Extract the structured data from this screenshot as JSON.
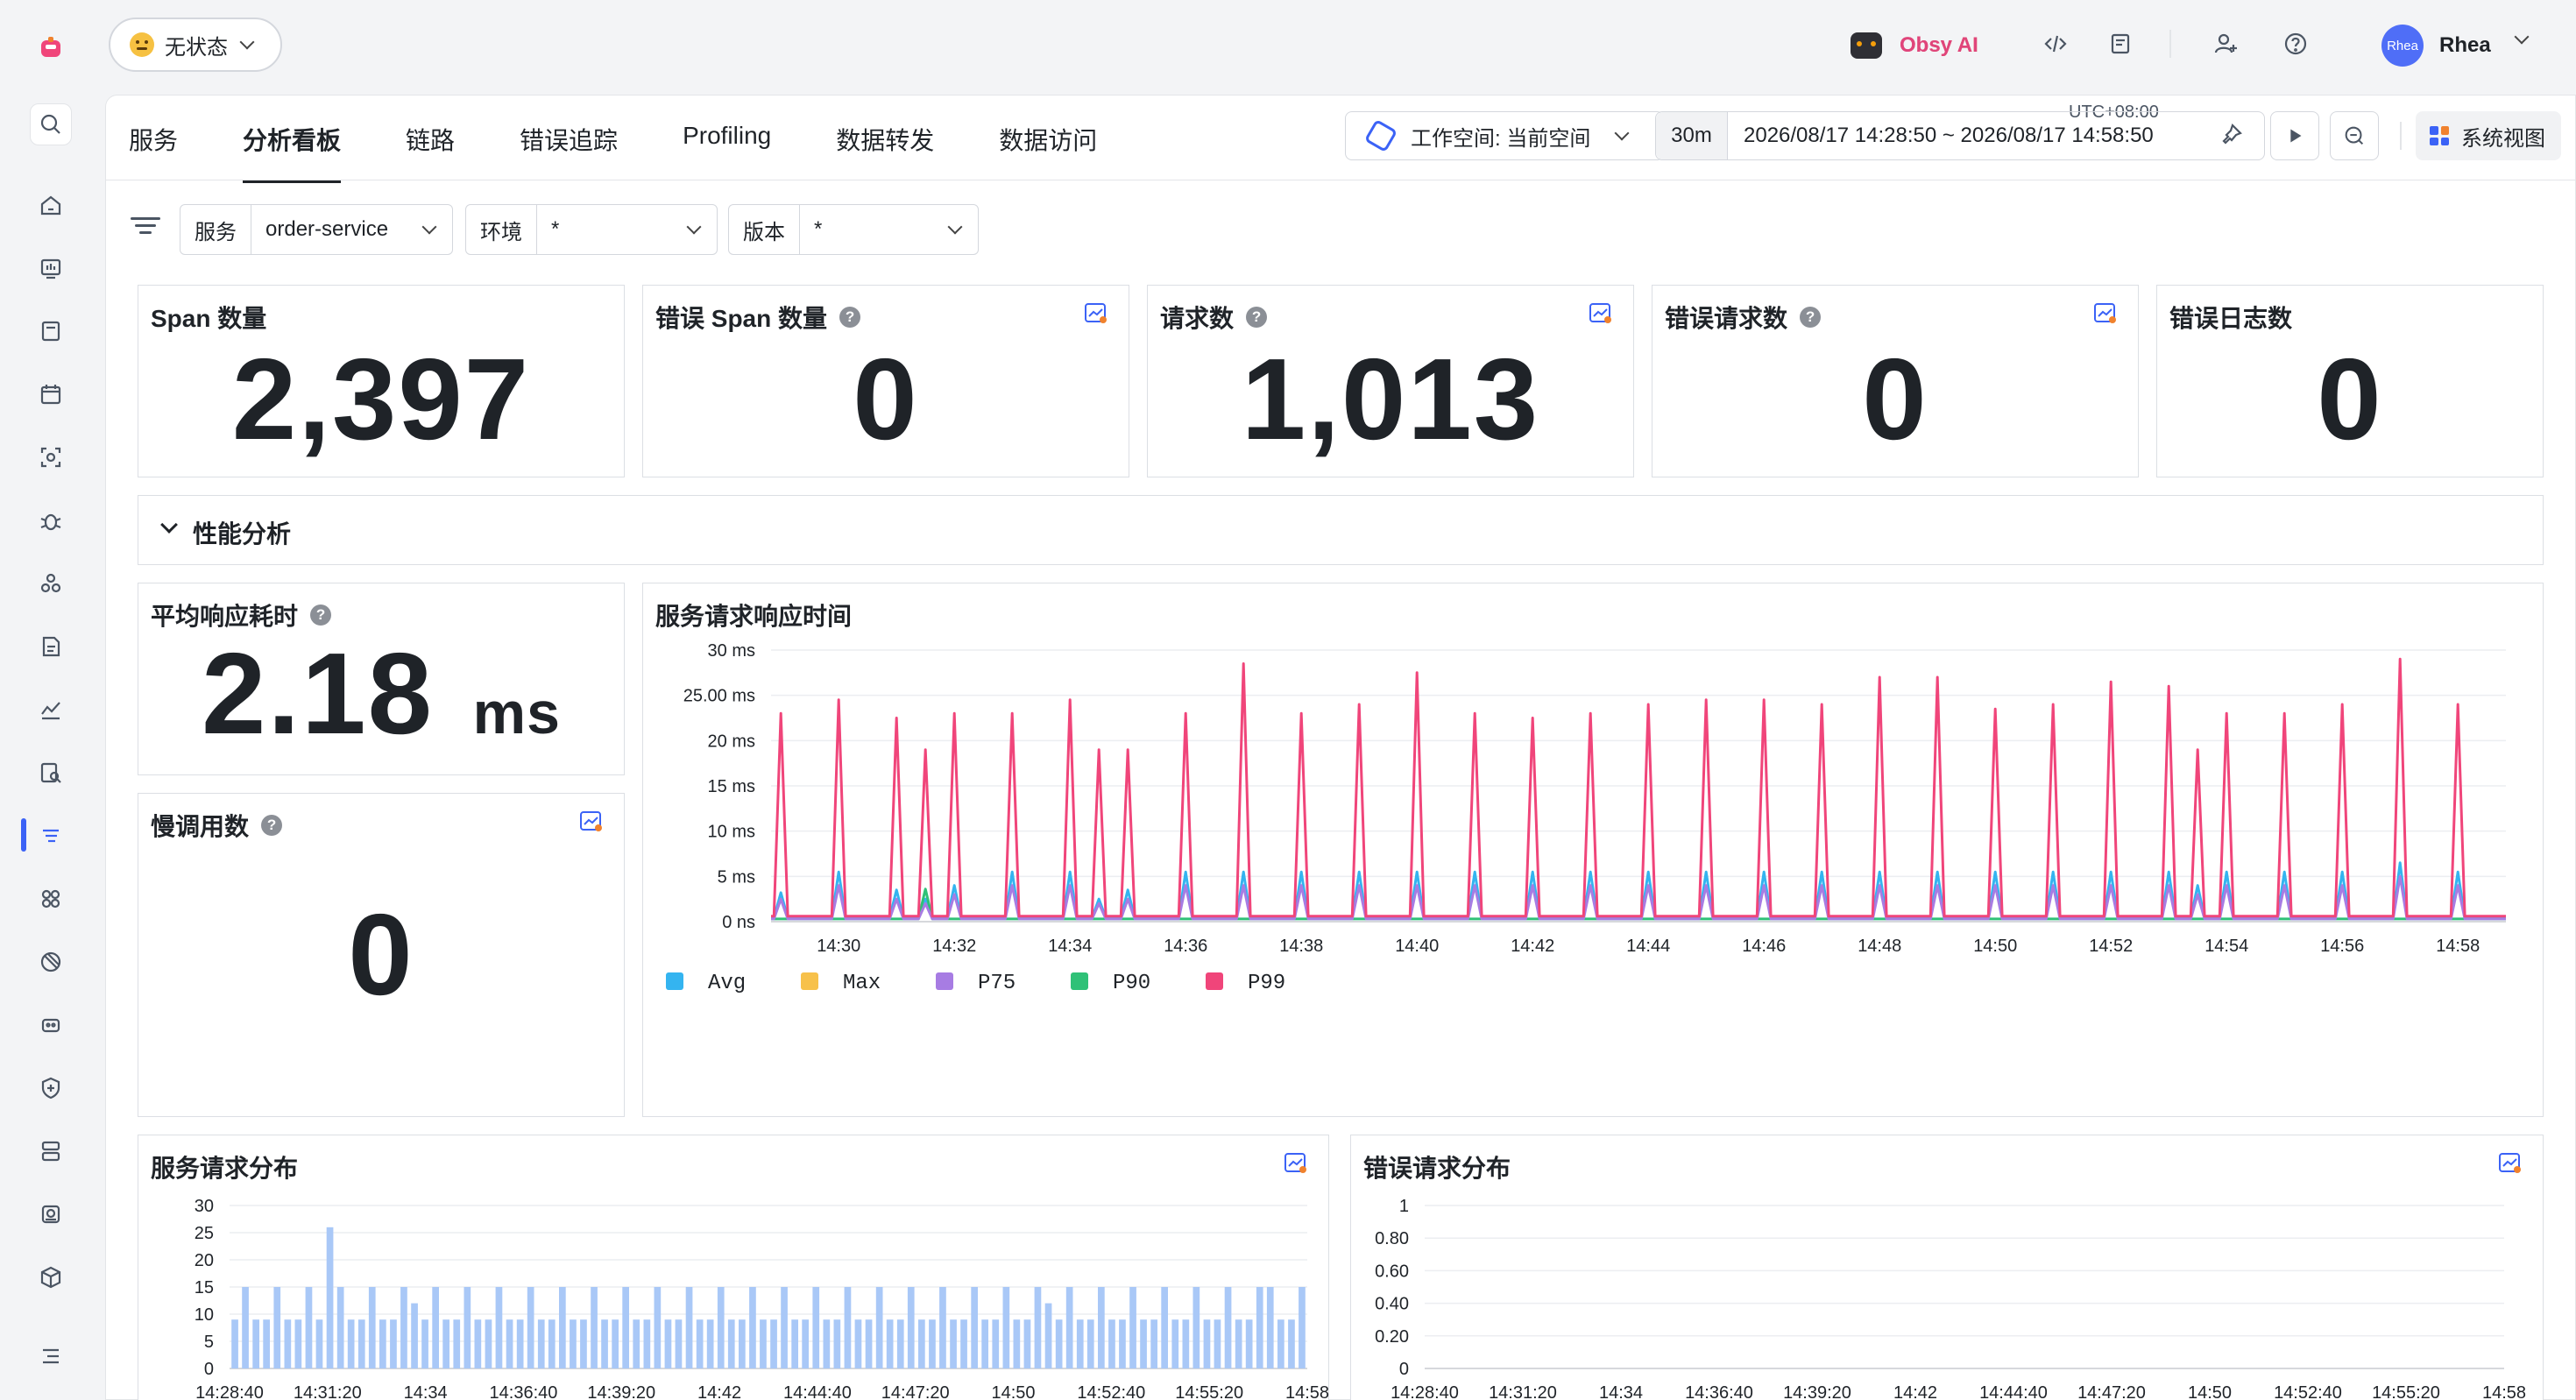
{
  "topbar": {
    "status_label": "无状态",
    "ai_label": "Obsy AI",
    "user_avatar_text": "Rhea",
    "user_name": "Rhea"
  },
  "tabs": [
    {
      "label": "服务",
      "active": false
    },
    {
      "label": "分析看板",
      "active": true
    },
    {
      "label": "链路",
      "active": false
    },
    {
      "label": "错误追踪",
      "active": false
    },
    {
      "label": "Profiling",
      "active": false
    },
    {
      "label": "数据转发",
      "active": false
    },
    {
      "label": "数据访问",
      "active": false
    }
  ],
  "toolbar": {
    "workspace_label": "工作空间: 当前空间",
    "time_short": "30m",
    "time_range": "2026/08/17 14:28:50 ~ 2026/08/17 14:58:50",
    "timezone": "UTC+08:00",
    "system_view_label": "系统视图"
  },
  "filters": {
    "service": {
      "label": "服务",
      "value": "order-service"
    },
    "env": {
      "label": "环境",
      "value": "*"
    },
    "version": {
      "label": "版本",
      "value": "*"
    }
  },
  "stats": {
    "span_count": {
      "title": "Span 数量",
      "value": "2,397"
    },
    "error_span_count": {
      "title": "错误 Span 数量",
      "value": "0"
    },
    "request_count": {
      "title": "请求数",
      "value": "1,013"
    },
    "error_request_count": {
      "title": "错误请求数",
      "value": "0"
    },
    "error_log_count": {
      "title": "错误日志数",
      "value": "0"
    }
  },
  "section": {
    "title": "性能分析"
  },
  "avg_response": {
    "title": "平均响应耗时",
    "value": "2.18",
    "unit": "ms"
  },
  "slow_calls": {
    "title": "慢调用数",
    "value": "0"
  },
  "colors": {
    "accent": "#3b62f6",
    "avg": "#34b4f0",
    "max": "#f7c14a",
    "p75": "#a77ce3",
    "p90": "#2fc177",
    "p99": "#f0457a",
    "bar": "#a9c8f7"
  },
  "chart_data": [
    {
      "type": "line",
      "title": "服务请求响应时间",
      "ylim": [
        0,
        30
      ],
      "y_ticks": [
        "30 ms",
        "25.00 ms",
        "20 ms",
        "15 ms",
        "10 ms",
        "5 ms",
        "0 ns"
      ],
      "x_ticks": [
        "14:30",
        "14:32",
        "14:34",
        "14:36",
        "14:38",
        "14:40",
        "14:42",
        "14:44",
        "14:46",
        "14:48",
        "14:50",
        "14:52",
        "14:54",
        "14:56",
        "14:58"
      ],
      "legend_position": "bottom-left",
      "grid": true,
      "x_minutes": [
        28.83,
        29,
        29.5,
        30,
        30.5,
        31,
        31.5,
        32,
        32.5,
        33,
        33.5,
        34,
        34.5,
        35,
        35.5,
        36,
        36.5,
        37,
        37.5,
        38,
        38.5,
        39,
        39.5,
        40,
        40.5,
        41,
        41.5,
        42,
        42.5,
        43,
        43.5,
        44,
        44.5,
        45,
        45.5,
        46,
        46.5,
        47,
        47.5,
        48,
        48.5,
        49,
        49.5,
        50,
        50.5,
        51,
        51.5,
        52,
        52.5,
        53,
        53.5,
        54,
        54.5,
        55,
        55.5,
        56,
        56.5,
        57,
        57.5,
        58,
        58.5,
        58.83
      ],
      "series": [
        {
          "name": "Avg",
          "peaks": [
            [
              29,
              3.2
            ],
            [
              30,
              5.5
            ],
            [
              31,
              3.5
            ],
            [
              31.5,
              2.5
            ],
            [
              32,
              4.0
            ],
            [
              33,
              5.5
            ],
            [
              34,
              5.5
            ],
            [
              34.5,
              2.5
            ],
            [
              35,
              3.5
            ],
            [
              36,
              5.5
            ],
            [
              37,
              5.5
            ],
            [
              38,
              5.5
            ],
            [
              39,
              5.5
            ],
            [
              40,
              5.5
            ],
            [
              41,
              5.5
            ],
            [
              42,
              5.5
            ],
            [
              43,
              5.5
            ],
            [
              44,
              5.5
            ],
            [
              45,
              5.5
            ],
            [
              46,
              5.5
            ],
            [
              47,
              5.5
            ],
            [
              48,
              5.5
            ],
            [
              49,
              5.5
            ],
            [
              50,
              5.5
            ],
            [
              51,
              5.5
            ],
            [
              52,
              5.5
            ],
            [
              53,
              5.5
            ],
            [
              53.5,
              4.0
            ],
            [
              54,
              5.5
            ],
            [
              55,
              5.5
            ],
            [
              56,
              5.5
            ],
            [
              57,
              6.5
            ],
            [
              58,
              5.5
            ]
          ]
        },
        {
          "name": "Max",
          "peaks": []
        },
        {
          "name": "P75",
          "peaks": [
            [
              29,
              2.5
            ],
            [
              30,
              4.0
            ],
            [
              31,
              2.5
            ],
            [
              31.5,
              2.0
            ],
            [
              32,
              3.0
            ],
            [
              33,
              4.0
            ],
            [
              34,
              4.0
            ],
            [
              34.5,
              2.0
            ],
            [
              35,
              2.5
            ],
            [
              36,
              4.0
            ],
            [
              37,
              4.0
            ],
            [
              38,
              4.0
            ],
            [
              39,
              4.0
            ],
            [
              40,
              4.0
            ],
            [
              41,
              4.0
            ],
            [
              42,
              4.0
            ],
            [
              43,
              4.0
            ],
            [
              44,
              4.0
            ],
            [
              45,
              4.0
            ],
            [
              46,
              4.0
            ],
            [
              47,
              4.0
            ],
            [
              48,
              4.0
            ],
            [
              49,
              4.0
            ],
            [
              50,
              4.0
            ],
            [
              51,
              4.0
            ],
            [
              52,
              4.0
            ],
            [
              53,
              4.0
            ],
            [
              53.5,
              3.0
            ],
            [
              54,
              4.0
            ],
            [
              55,
              4.0
            ],
            [
              56,
              4.0
            ],
            [
              57,
              5.0
            ],
            [
              58,
              4.0
            ]
          ]
        },
        {
          "name": "P90",
          "peaks": [
            [
              31.5,
              3.6
            ]
          ]
        },
        {
          "name": "P99",
          "peaks": [
            [
              29,
              23.0
            ],
            [
              30,
              24.5
            ],
            [
              31,
              22.5
            ],
            [
              31.5,
              19.0
            ],
            [
              32,
              23.0
            ],
            [
              33,
              23.0
            ],
            [
              34,
              24.5
            ],
            [
              34.5,
              19.0
            ],
            [
              35,
              19.0
            ],
            [
              36,
              23.0
            ],
            [
              37,
              28.5
            ],
            [
              38,
              23.0
            ],
            [
              39,
              24.0
            ],
            [
              40,
              27.5
            ],
            [
              41,
              23.0
            ],
            [
              42,
              22.5
            ],
            [
              43,
              23.0
            ],
            [
              44,
              24.0
            ],
            [
              45,
              24.5
            ],
            [
              46,
              24.5
            ],
            [
              47,
              24.0
            ],
            [
              48,
              27.0
            ],
            [
              49,
              27.0
            ],
            [
              50,
              23.5
            ],
            [
              51,
              24.0
            ],
            [
              52,
              26.5
            ],
            [
              53,
              26.0
            ],
            [
              53.5,
              19.0
            ],
            [
              54,
              23.0
            ],
            [
              55,
              23.0
            ],
            [
              56,
              24.0
            ],
            [
              57,
              29.0
            ],
            [
              58,
              24.0
            ],
            [
              59,
              24.5
            ]
          ]
        }
      ]
    },
    {
      "type": "bar",
      "title": "服务请求分布",
      "ylim": [
        0,
        30
      ],
      "y_ticks": [
        "30",
        "25",
        "20",
        "15",
        "10",
        "5",
        "0"
      ],
      "x_ticks": [
        "14:28:40",
        "14:31:20",
        "14:34",
        "14:36:40",
        "14:39:20",
        "14:42",
        "14:44:40",
        "14:47:20",
        "14:50",
        "14:52:40",
        "14:55:20",
        "14:58"
      ],
      "grid": true,
      "values": [
        9,
        15,
        9,
        9,
        15,
        9,
        9,
        15,
        9,
        26,
        15,
        9,
        9,
        15,
        9,
        9,
        15,
        12,
        9,
        15,
        9,
        9,
        15,
        9,
        9,
        15,
        9,
        9,
        15,
        9,
        9,
        15,
        9,
        9,
        15,
        9,
        9,
        15,
        9,
        9,
        15,
        9,
        9,
        15,
        9,
        9,
        15,
        9,
        9,
        15,
        9,
        9,
        15,
        9,
        9,
        15,
        9,
        9,
        15,
        9,
        9,
        15,
        9,
        9,
        15,
        9,
        9,
        15,
        9,
        9,
        15,
        9,
        9,
        15,
        9,
        9,
        15,
        12,
        9,
        15,
        9,
        9,
        15,
        9,
        9,
        15,
        9,
        9,
        15,
        9,
        9,
        15,
        9,
        9,
        15,
        9,
        9,
        15,
        15,
        9,
        9,
        15
      ]
    },
    {
      "type": "bar",
      "title": "错误请求分布",
      "ylim": [
        0,
        1
      ],
      "y_ticks": [
        "1",
        "0.80",
        "0.60",
        "0.40",
        "0.20",
        "0"
      ],
      "x_ticks": [
        "14:28:40",
        "14:31:20",
        "14:34",
        "14:36:40",
        "14:39:20",
        "14:42",
        "14:44:40",
        "14:47:20",
        "14:50",
        "14:52:40",
        "14:55:20",
        "14:58"
      ],
      "grid": true,
      "values": []
    }
  ]
}
